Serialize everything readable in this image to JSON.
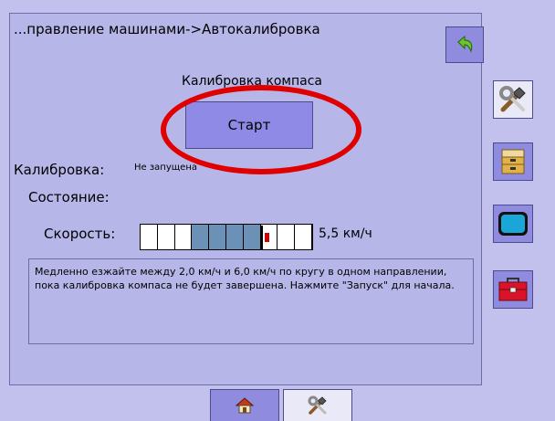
{
  "header": {
    "breadcrumb": "...правление машинами->Автокалибровка"
  },
  "compass": {
    "title": "Калибровка компаса",
    "start_label": "Старт"
  },
  "calibration": {
    "label": "Калибровка:",
    "value": "Не запущена"
  },
  "state": {
    "label": "Состояние:"
  },
  "speed": {
    "label": "Скорость:",
    "value": "5,5 км/ч",
    "active_segments": [
      3,
      4,
      5,
      6
    ],
    "total_segments": 10
  },
  "instructions": {
    "text": "Медленно езжайте между 2,0 км/ч и 6,0 км/ч по кругу в одном направлении, пока калибровка компаса не будет завершена. Нажмите \"Запуск\" для начала."
  },
  "colors": {
    "background": "#c2c0ed",
    "button": "#8f8ce0",
    "highlight": "#e00000",
    "bar_fill": "#6b91b6"
  },
  "sidebar": {
    "icons": [
      "tools-icon",
      "file-cabinet-icon",
      "display-icon",
      "toolbox-icon"
    ]
  },
  "bottom_tabs": {
    "icons": [
      "home-icon",
      "tools-icon"
    ]
  }
}
